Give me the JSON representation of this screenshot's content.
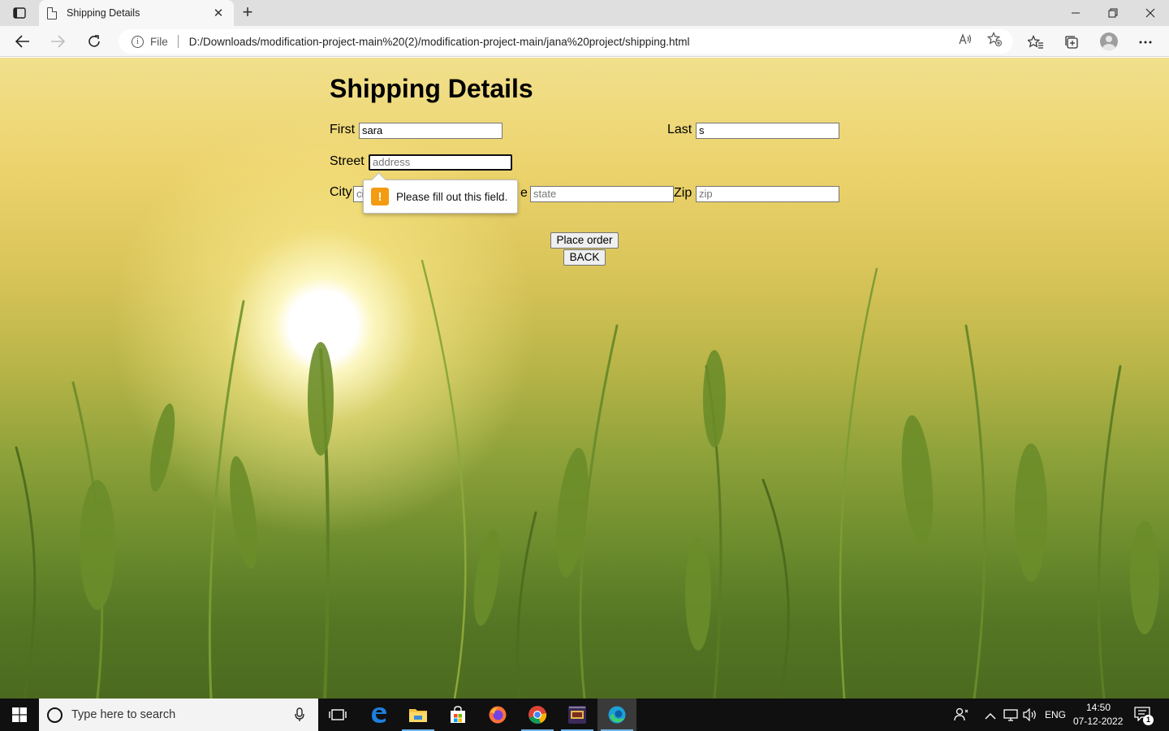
{
  "browser": {
    "tab_title": "Shipping Details",
    "tab_close": "✕",
    "new_tab": "+",
    "address_scheme": "File",
    "address_url": "D:/Downloads/modification-project-main%20(2)/modification-project-main/jana%20project/shipping.html"
  },
  "page": {
    "title": "Shipping Details",
    "first_label": "First",
    "first_value": "sara",
    "last_label": "Last",
    "last_value": "s",
    "street_label": "Street",
    "street_placeholder": "address",
    "city_label": "City",
    "city_placeholder": "ci",
    "state_label_fragment": "e",
    "state_placeholder": "state",
    "zip_label": "Zip",
    "zip_placeholder": "zip",
    "place_order_label": "Place order",
    "back_label": "BACK",
    "validation_message": "Please fill out this field.",
    "validation_icon": "!"
  },
  "taskbar": {
    "search_placeholder": "Type here to search",
    "language": "ENG",
    "time": "14:50",
    "date": "07-12-2022",
    "notification_count": "1"
  }
}
